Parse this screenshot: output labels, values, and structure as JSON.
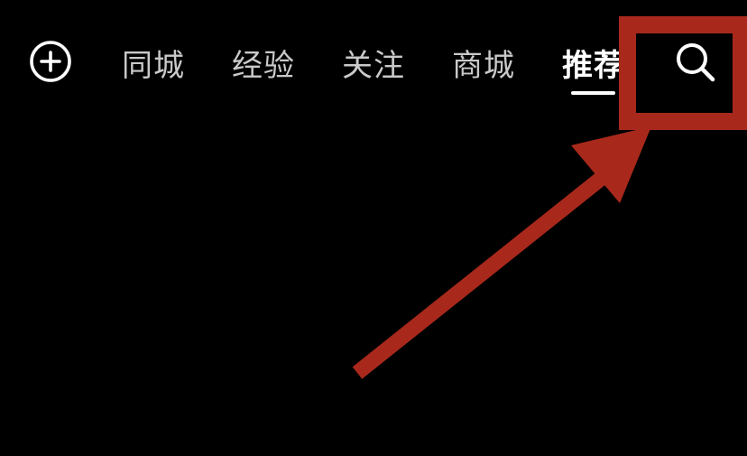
{
  "top_nav": {
    "add_icon": "plus-circle-icon",
    "tabs": [
      {
        "label": "同城"
      },
      {
        "label": "经验"
      },
      {
        "label": "关注"
      },
      {
        "label": "商城"
      },
      {
        "label": "推荐",
        "active": true
      }
    ],
    "search_icon": "search-icon"
  },
  "annotation": {
    "color": "#a8291c",
    "type": "highlight-box-with-arrow"
  },
  "colors": {
    "background": "#000000",
    "tab_text": "#c9c9c9",
    "tab_active": "#ffffff"
  }
}
